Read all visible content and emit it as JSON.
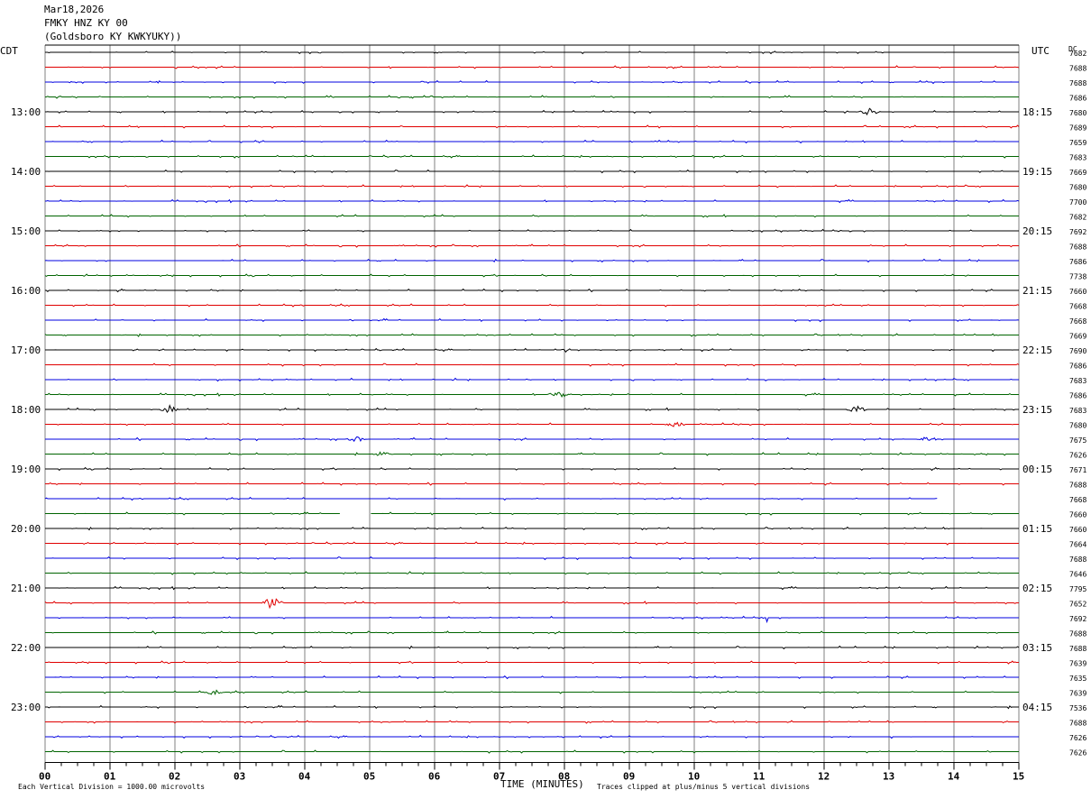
{
  "header": {
    "date": "Mar18,2026",
    "station": "FMKY HNZ KY 00",
    "location": "(Goldsboro KY KWKYUKY))",
    "left_zone": "CDT",
    "right_zone": "UTC",
    "dc_label": "DC"
  },
  "chart_data": {
    "type": "line",
    "title": "FMKY HNZ KY 00",
    "xlabel": "TIME (MINUTES)",
    "x_ticks": [
      "00",
      "01",
      "02",
      "03",
      "04",
      "05",
      "06",
      "07",
      "08",
      "09",
      "10",
      "11",
      "12",
      "13",
      "14",
      "15"
    ],
    "xlim": [
      0,
      15
    ],
    "grid": true,
    "trace_colors": [
      "#000000",
      "#e00000",
      "#0000e0",
      "#006400"
    ],
    "traces_count": 48,
    "minutes_per_trace": 15,
    "left_time_labels": [
      "13:00",
      "14:00",
      "15:00",
      "16:00",
      "17:00",
      "18:00",
      "19:00",
      "20:00",
      "21:00",
      "22:00",
      "23:00"
    ],
    "right_time_labels": [
      "18:15",
      "19:15",
      "20:15",
      "21:15",
      "22:15",
      "23:15",
      "00:15",
      "01:15",
      "02:15",
      "03:15",
      "04:15"
    ],
    "dc_offsets": [
      "7682",
      "7688",
      "7688",
      "7686",
      "7680",
      "7689",
      "7659",
      "7683",
      "7669",
      "7680",
      "7700",
      "7682",
      "7692",
      "7688",
      "7686",
      "7738",
      "7660",
      "7668",
      "7668",
      "7669",
      "7690",
      "7686",
      "7683",
      "7686",
      "7683",
      "7680",
      "7675",
      "7626",
      "7671",
      "7688",
      "7668",
      "7660",
      "7660",
      "7664",
      "7688",
      "7646",
      "7795",
      "7652",
      "7692",
      "7688",
      "7688",
      "7639",
      "7635",
      "7639",
      "7536",
      "7688",
      "7626",
      "7626"
    ],
    "events": [
      {
        "trace": 27,
        "minute": 5.2,
        "amp": 3,
        "type": "burst"
      },
      {
        "trace": 37,
        "minute": 3.5,
        "amp": 7,
        "type": "burst"
      },
      {
        "trace": 38,
        "minute": 11.1,
        "amp": 6,
        "type": "spike"
      },
      {
        "trace": 24,
        "minute": 1.9,
        "amp": 5,
        "type": "burst"
      },
      {
        "trace": 24,
        "minute": 12.5,
        "amp": 5,
        "type": "burst"
      },
      {
        "trace": 23,
        "minute": 7.9,
        "amp": 4,
        "type": "burst"
      },
      {
        "trace": 20,
        "minute": 8.0,
        "amp": 4,
        "type": "spike"
      },
      {
        "trace": 43,
        "minute": 2.6,
        "amp": 3,
        "type": "burst"
      },
      {
        "trace": 25,
        "minute": 9.7,
        "amp": 3,
        "type": "burst"
      },
      {
        "trace": 26,
        "minute": 4.8,
        "amp": 3,
        "type": "burst"
      },
      {
        "trace": 26,
        "minute": 13.6,
        "amp": 3,
        "type": "burst"
      },
      {
        "trace": 4,
        "minute": 12.7,
        "amp": 4,
        "type": "burst"
      }
    ],
    "gaps": [
      {
        "trace": 31,
        "start": 4.55,
        "end": 5.0
      },
      {
        "trace": 30,
        "start": 13.75,
        "end": 15.0
      }
    ],
    "last_trace_partial": {
      "trace": 31,
      "end": 13.75
    }
  },
  "footer": {
    "scale_note": "Each Vertical Division = 1000.00 microvolts",
    "clip_note": "Traces clipped at plus/minus 5 vertical divisions"
  }
}
